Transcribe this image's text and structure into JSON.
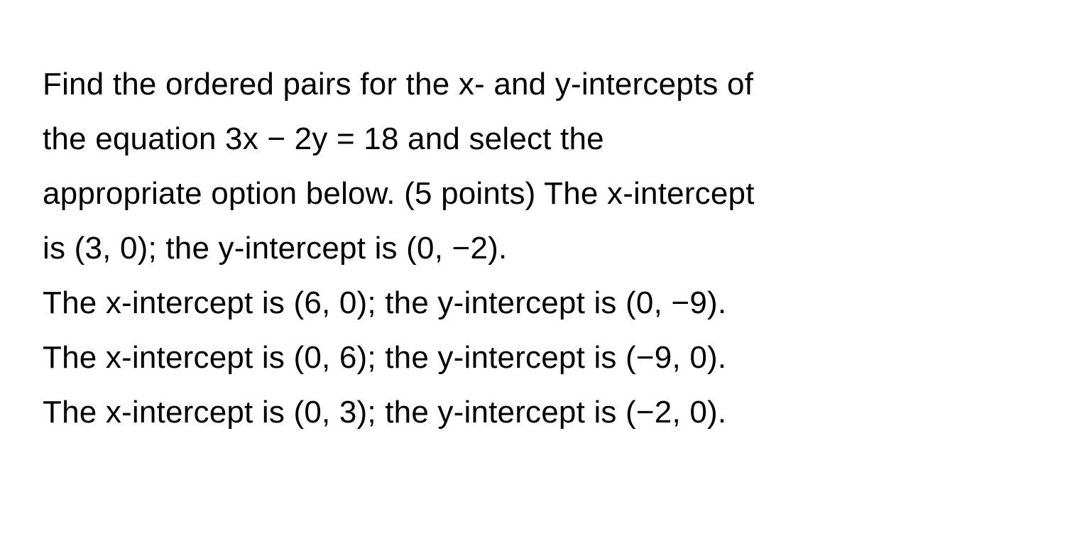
{
  "question": {
    "line1": "Find the ordered pairs for the x- and y-intercepts of",
    "line2": "the equation 3x − 2y = 18 and select the",
    "line3": "appropriate option below. (5 points) The x-intercept",
    "line4": "is (3, 0); the y-intercept is (0, −2).",
    "line5": "The x-intercept is (6, 0); the y-intercept is (0, −9).",
    "line6": "The x-intercept is (0, 6); the y-intercept is (−9, 0).",
    "line7": "The x-intercept is (0, 3); the y-intercept is (−2, 0)."
  }
}
